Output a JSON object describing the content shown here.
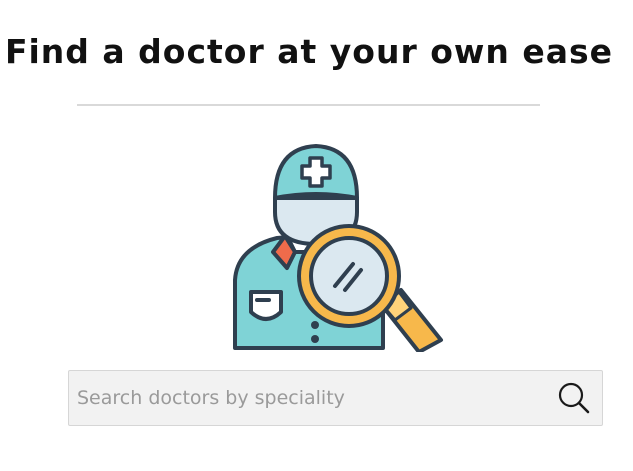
{
  "header": {
    "title": "Find a doctor at your own ease"
  },
  "illustration": {
    "icon": "doctor-with-magnifying-glass"
  },
  "search": {
    "placeholder": "Search doctors by speciality",
    "value": "",
    "icon": "search-icon"
  }
}
